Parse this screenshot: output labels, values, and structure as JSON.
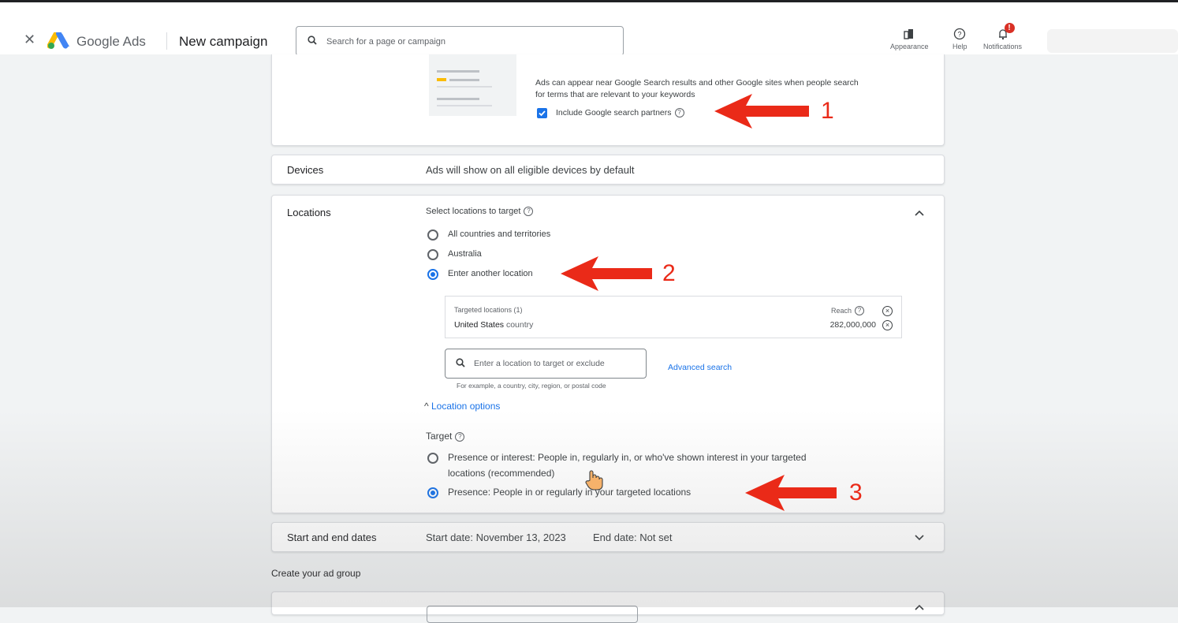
{
  "header": {
    "close_icon": "close-icon",
    "brand": "Google Ads",
    "page_title": "New campaign",
    "search_placeholder": "Search for a page or campaign",
    "appearance_label": "Appearance",
    "help_label": "Help",
    "notifications_label": "Notifications",
    "notifications_badge": "!"
  },
  "network_card": {
    "description_line1": "Ads can appear near Google Search results and other Google sites when people search",
    "description_line2": "for terms that are relevant to your keywords",
    "checkbox_label": "Include Google search partners",
    "checkbox_checked": true
  },
  "devices": {
    "label": "Devices",
    "text": "Ads will show on all eligible devices by default"
  },
  "locations": {
    "label": "Locations",
    "select_label": "Select locations to target",
    "options": [
      "All countries and territories",
      "Australia",
      "Enter another location"
    ],
    "selected_option": "Enter another location",
    "targeted_header": "Targeted locations (1)",
    "reach_label": "Reach",
    "targeted_name": "United States",
    "targeted_type": "country",
    "targeted_reach": "282,000,000",
    "location_input_placeholder": "Enter a location to target or exclude",
    "location_input_hint": "For example, a country, city, region, or postal code",
    "advanced_search": "Advanced search",
    "location_options_toggle": "Location options",
    "target_label": "Target",
    "target_option1_line1": "Presence or interest: People in, regularly in, or who've shown interest in your targeted",
    "target_option1_line2": "locations (recommended)",
    "target_option2": "Presence: People in or regularly in your targeted locations",
    "target_selected": "Presence"
  },
  "dates": {
    "label": "Start and end dates",
    "start": "Start date: November 13, 2023",
    "end": "End date: Not set"
  },
  "ad_group_heading": "Create your ad group",
  "annotations": {
    "n1": "1",
    "n2": "2",
    "n3": "3",
    "arrow_color": "#ea2a18"
  },
  "colors": {
    "accent": "#1a73e8",
    "badge": "#d93025"
  }
}
